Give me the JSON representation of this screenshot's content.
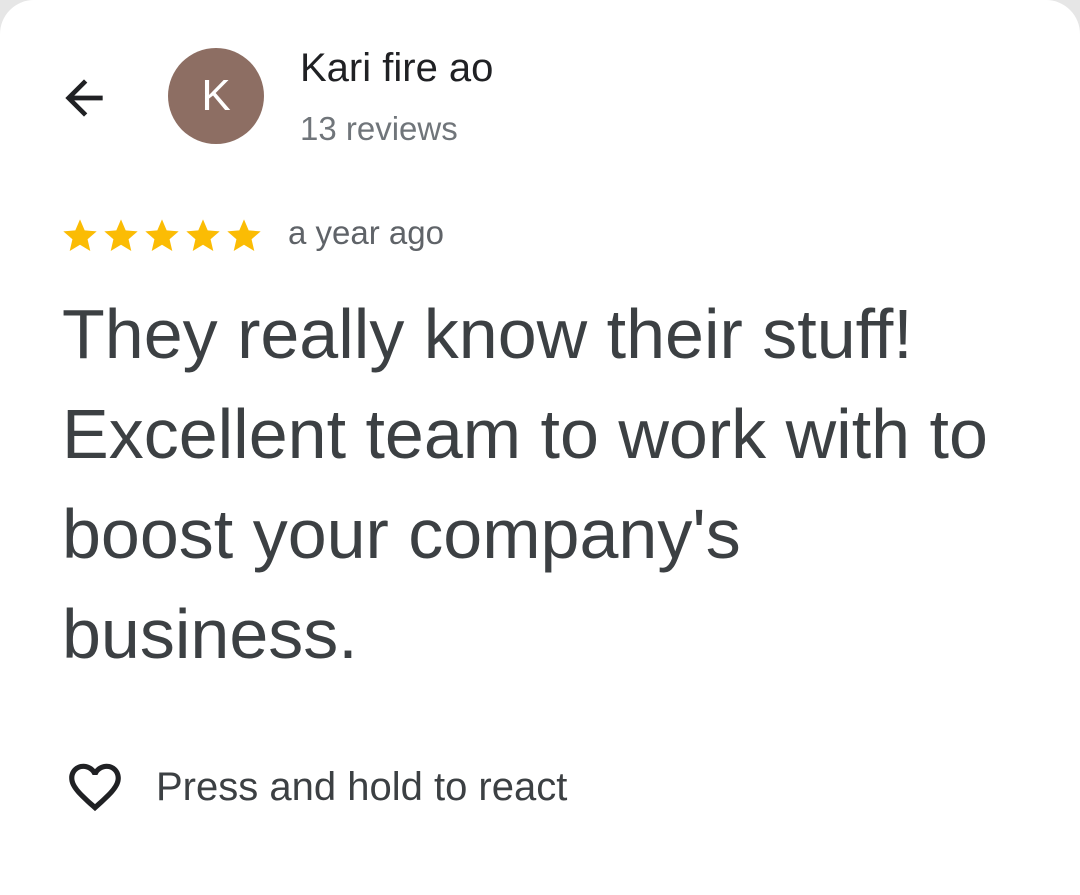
{
  "header": {
    "back_icon": "arrow-back-icon",
    "avatar_initial": "K",
    "avatar_color": "#8d6e63",
    "author_name": "Kari fire ao",
    "review_count": "13 reviews"
  },
  "review": {
    "rating": 5,
    "rating_max": 5,
    "star_color": "#fbbc04",
    "date": "a year ago",
    "text": "They really know their stuff! Excellent team to work with to boost your company's business."
  },
  "footer": {
    "react_icon": "heart-outline-icon",
    "react_label": "Press and hold to react"
  }
}
